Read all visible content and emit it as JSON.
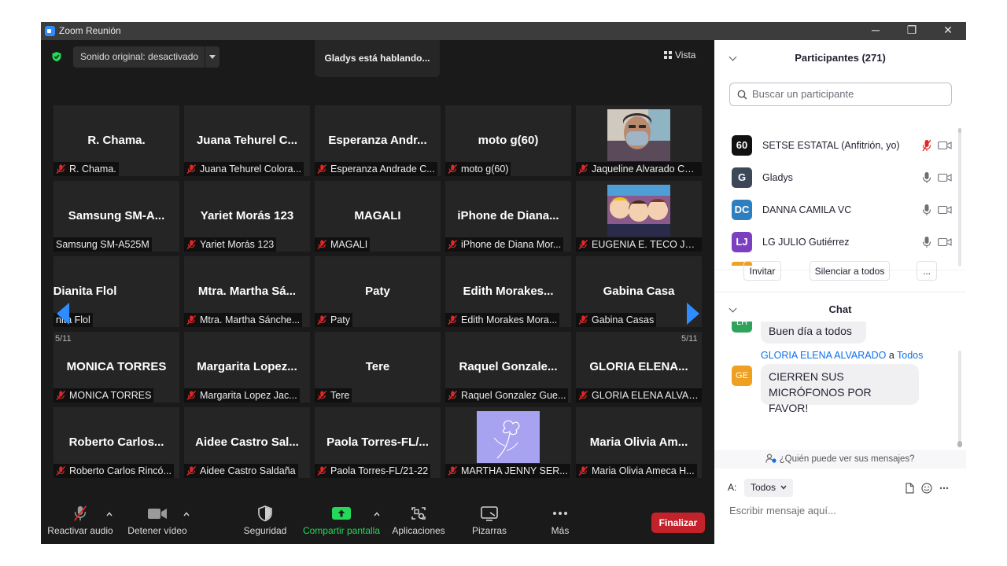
{
  "window": {
    "title": "Zoom Reunión",
    "controls": [
      "─",
      "❐",
      "✕"
    ]
  },
  "video": {
    "audio_option": "Sonido original: desactivado",
    "speaking": "Gladys está hablando...",
    "view_label": "Vista",
    "page_left": "5/11",
    "page_right": "5/11",
    "tiles": [
      {
        "big": "R. Chama.",
        "caption": "R. Chama.",
        "muted": true
      },
      {
        "big": "Juana Tehurel C...",
        "caption": "Juana Tehurel Colora...",
        "muted": true
      },
      {
        "big": "Esperanza Andr...",
        "caption": "Esperanza Andrade C...",
        "muted": true
      },
      {
        "big": "moto g(60)",
        "caption": "moto g(60)",
        "muted": true
      },
      {
        "big": "",
        "caption": "Jaqueline Alvarado Candia",
        "muted": true,
        "photo": "face-mask"
      },
      {
        "big": "Samsung SM-A...",
        "caption": "Samsung SM-A525M",
        "muted": false
      },
      {
        "big": "Yariet Morás 123",
        "caption": "Yariet Morás 123",
        "muted": true
      },
      {
        "big": "MAGALI",
        "caption": "MAGALI",
        "muted": true
      },
      {
        "big": "iPhone de Diana...",
        "caption": "iPhone de Diana Mor...",
        "muted": true
      },
      {
        "big": "",
        "caption": "EUGENIA E. TECO JÁ...",
        "muted": true,
        "photo": "cartoon"
      },
      {
        "big": "Dianita Flol",
        "caption": "nita Flol",
        "muted": false,
        "cut": true
      },
      {
        "big": "Mtra. Martha Sá...",
        "caption": "Mtra. Martha Sánche...",
        "muted": true
      },
      {
        "big": "Paty",
        "caption": "Paty",
        "muted": true
      },
      {
        "big": "Edith Morakes...",
        "caption": "Edith Morakes Mora...",
        "muted": true
      },
      {
        "big": "Gabina Casa",
        "caption": "Gabina Casas",
        "muted": true
      },
      {
        "big": "MONICA TORRES",
        "caption": "MONICA TORRES",
        "muted": true
      },
      {
        "big": "Margarita Lopez...",
        "caption": "Margarita Lopez Jac...",
        "muted": true
      },
      {
        "big": "Tere",
        "caption": "Tere",
        "muted": true
      },
      {
        "big": "Raquel Gonzale...",
        "caption": "Raquel Gonzalez Gue...",
        "muted": true
      },
      {
        "big": "GLORIA ELENA...",
        "caption": "GLORIA ELENA ALVAR...",
        "muted": true
      },
      {
        "big": "Roberto Carlos...",
        "caption": "Roberto Carlos Rincó...",
        "muted": true
      },
      {
        "big": "Aidee Castro Sal...",
        "caption": "Aidee Castro Saldaña",
        "muted": true
      },
      {
        "big": "Paola Torres-FL/...",
        "caption": "Paola Torres-FL/21-22",
        "muted": true
      },
      {
        "big": "",
        "caption": "MARTHA JENNY SER...",
        "muted": true,
        "photo": "flower"
      },
      {
        "big": "Maria Olivia Am...",
        "caption": "Maria Olivia Ameca H...",
        "muted": true
      }
    ]
  },
  "toolbar": {
    "audio": "Reactivar audio",
    "video": "Detener vídeo",
    "security": "Seguridad",
    "share": "Compartir pantalla",
    "apps": "Aplicaciones",
    "whiteboard": "Pizarras",
    "more": "Más",
    "end": "Finalizar"
  },
  "participants": {
    "title": "Participantes (271)",
    "search_placeholder": "Buscar un participante",
    "list": [
      {
        "initials": "60",
        "name": "SETSE ESTATAL (Anfitrión, yo)",
        "color": "#111111",
        "mic_muted": true
      },
      {
        "initials": "G",
        "name": "Gladys",
        "color": "#3c4858",
        "mic_muted": false
      },
      {
        "initials": "DC",
        "name": "DANNA CAMILA VC",
        "color": "#2e7fbf",
        "mic_muted": false
      },
      {
        "initials": "LJ",
        "name": "LG JULIO Gutiérrez",
        "color": "#7b3fc0",
        "mic_muted": false
      }
    ],
    "invite": "Invitar",
    "mute_all": "Silenciar a todos",
    "more": "..."
  },
  "chat": {
    "title": "Chat",
    "messages": [
      {
        "initials": "LH",
        "color": "#2fa35a",
        "sender": "",
        "to": "",
        "recipient": "",
        "text": "Buen día a todos"
      },
      {
        "initials": "GE",
        "color": "#f0a020",
        "sender": "GLORIA ELENA ALVARADO",
        "to": "a",
        "recipient": "Todos",
        "text": "CIERREN SUS MICRÓFONOS POR FAVOR!"
      }
    ],
    "visibility": "¿Quién puede ver sus mensajes?",
    "to_label": "A:",
    "to_value": "Todos",
    "input_placeholder": "Escribir mensaje aquí..."
  },
  "colors": {
    "accent": "#0e71eb",
    "end_red": "#c4222a",
    "mute_red": "#e02828",
    "share_green": "#23d959"
  }
}
